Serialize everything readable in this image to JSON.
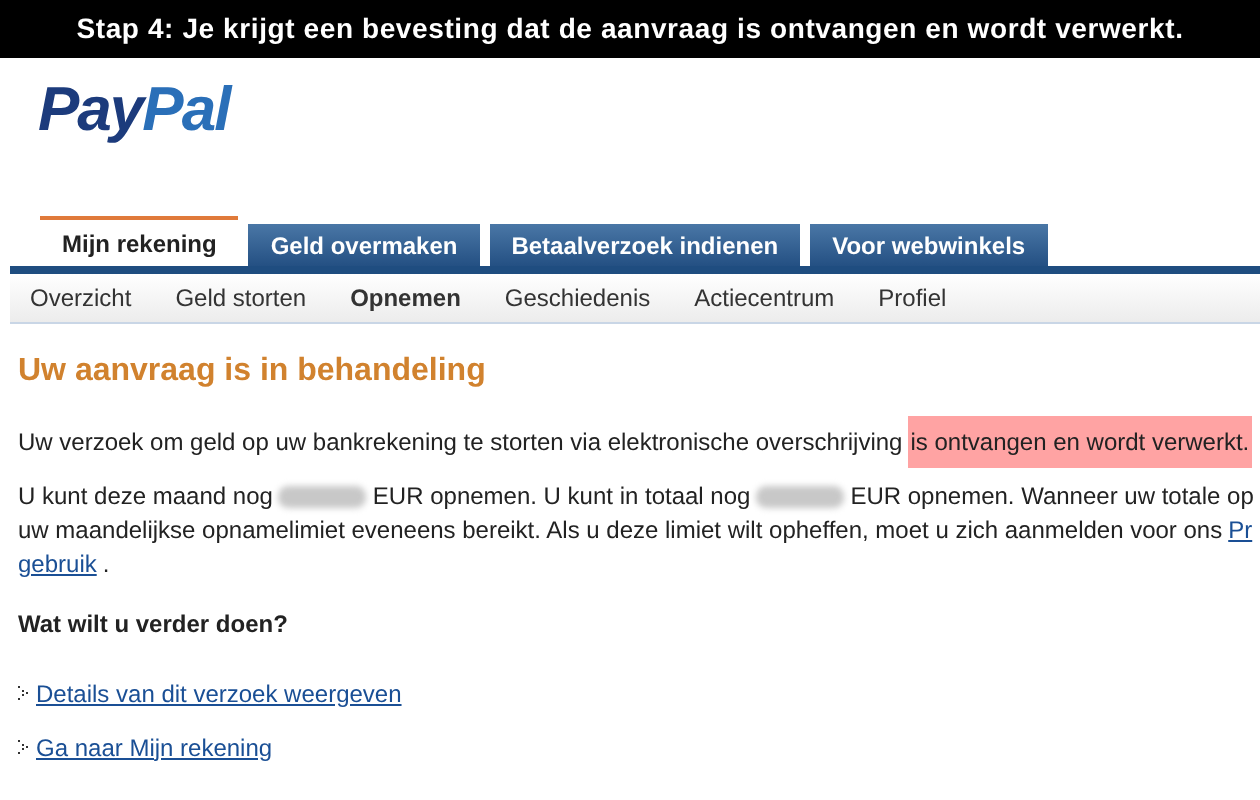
{
  "caption": "Stap 4: Je krijgt een bevesting dat de aanvraag is ontvangen en wordt verwerkt.",
  "logo": {
    "part_1": "Pay",
    "part_2": "Pal"
  },
  "tabs": [
    {
      "label": "Mijn rekening",
      "selected": true
    },
    {
      "label": "Geld overmaken",
      "selected": false
    },
    {
      "label": "Betaalverzoek indienen",
      "selected": false
    },
    {
      "label": "Voor webwinkels",
      "selected": false
    }
  ],
  "subnav": [
    {
      "label": "Overzicht",
      "selected": false
    },
    {
      "label": "Geld storten",
      "selected": false
    },
    {
      "label": "Opnemen",
      "selected": true
    },
    {
      "label": "Geschiedenis",
      "selected": false
    },
    {
      "label": "Actiecentrum",
      "selected": false
    },
    {
      "label": "Profiel",
      "selected": false
    }
  ],
  "heading": "Uw aanvraag is in behandeling",
  "confirmation": [
    {
      "text": "Uw verzoek om geld op uw bankrekening te storten via elektronische overschrijving",
      "highlighted": false
    },
    {
      "text": "is ontvangen en wordt verwerkt.",
      "highlighted": true
    }
  ],
  "limit_lines": [
    [
      {
        "kind": "text",
        "text": "U kunt deze maand nog"
      },
      {
        "kind": "redacted"
      },
      {
        "kind": "text",
        "text": "EUR opnemen. U kunt in totaal nog"
      },
      {
        "kind": "redacted"
      },
      {
        "kind": "text",
        "text": "EUR opnemen. Wanneer uw totale op"
      }
    ],
    [
      {
        "kind": "text",
        "text": "uw maandelijkse opnamelimiet eveneens bereikt. Als u deze limiet wilt opheffen, moet u zich aanmelden voor ons"
      },
      {
        "kind": "link",
        "text": "Pr"
      }
    ],
    [
      {
        "kind": "link",
        "text": "gebruik"
      },
      {
        "kind": "text",
        "text": "."
      }
    ]
  ],
  "question": "Wat wilt u verder doen?",
  "actions": [
    "Details van dit verzoek weergeven",
    "Ga naar Mijn rekening"
  ]
}
